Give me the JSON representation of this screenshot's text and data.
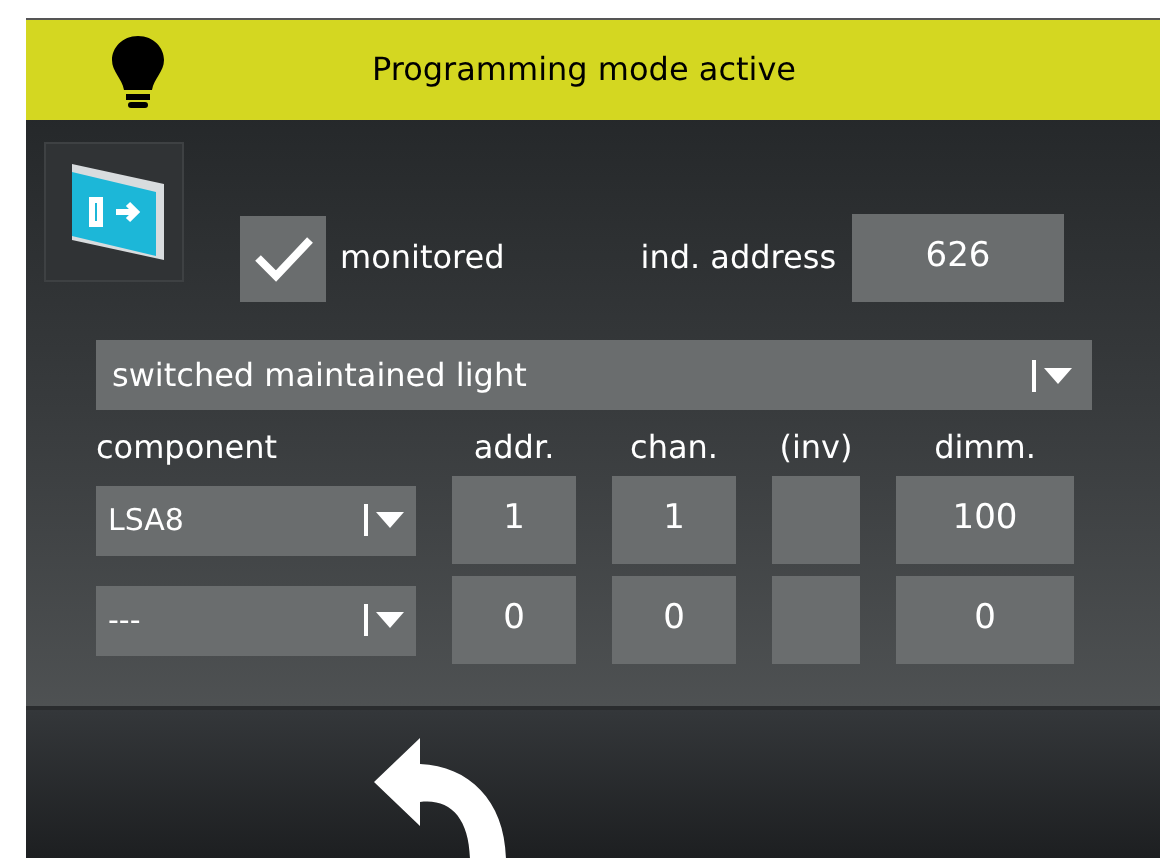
{
  "header": {
    "title": "Programming mode active"
  },
  "monitored": {
    "label": "monitored",
    "checked": true
  },
  "ind_address": {
    "label": "ind. address",
    "value": "626"
  },
  "mode": {
    "value": "switched maintained light"
  },
  "columns": [
    "component",
    "addr.",
    "chan.",
    "(inv)",
    "dimm."
  ],
  "rows": [
    {
      "component": "LSA8",
      "addr": "1",
      "chan": "1",
      "dimm": "100"
    },
    {
      "component": "---",
      "addr": "0",
      "chan": "0",
      "dimm": "0"
    }
  ]
}
